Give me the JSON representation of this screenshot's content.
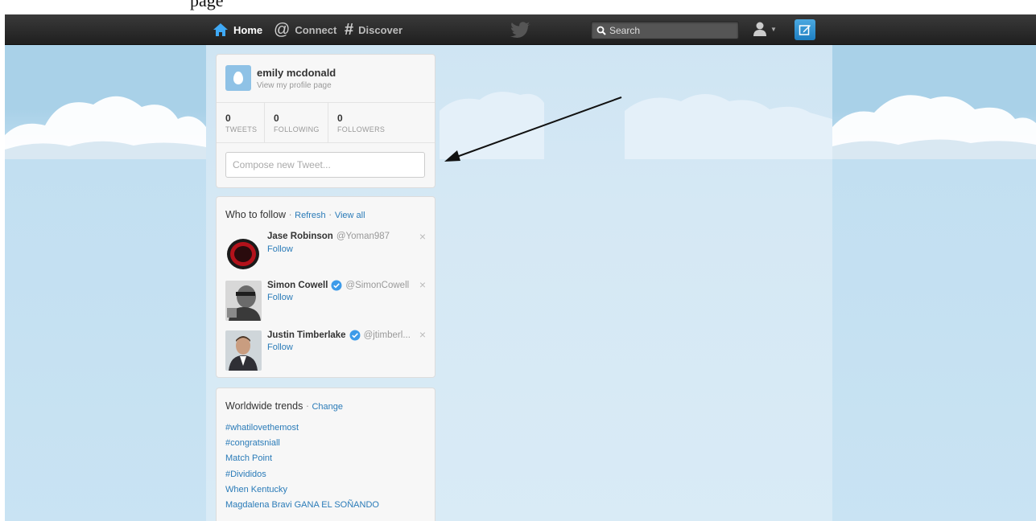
{
  "top_strip": {
    "text": "page"
  },
  "nav": {
    "home": "Home",
    "connect": "Connect",
    "discover": "Discover",
    "search_placeholder": "Search"
  },
  "profile": {
    "name": "emily mcdonald",
    "link": "View my profile page",
    "stats": [
      {
        "value": "0",
        "label": "TWEETS"
      },
      {
        "value": "0",
        "label": "FOLLOWING"
      },
      {
        "value": "0",
        "label": "FOLLOWERS"
      }
    ],
    "compose_placeholder": "Compose new Tweet..."
  },
  "who_to_follow": {
    "title": "Who to follow",
    "refresh": "Refresh",
    "view_all": "View all",
    "follow_label": "Follow",
    "dismiss": "×",
    "suggestions": [
      {
        "name": "Jase Robinson",
        "handle": "@Yoman987",
        "verified": false
      },
      {
        "name": "Simon Cowell",
        "handle": "@SimonCowell",
        "verified": true
      },
      {
        "name": "Justin Timberlake",
        "handle": "@jtimberl...",
        "verified": true
      }
    ]
  },
  "trends": {
    "title": "Worldwide trends",
    "change": "Change",
    "items": [
      "#whatilovethemost",
      "#congratsniall",
      "Match Point",
      "#Divididos",
      "When Kentucky",
      "Magdalena Bravi GANA EL SOÑANDO"
    ]
  },
  "colors": {
    "topbar": "#2b2b2b",
    "link": "#2a7bb8",
    "compose_button": "#2b8fd6",
    "sky": "#c3def0"
  }
}
